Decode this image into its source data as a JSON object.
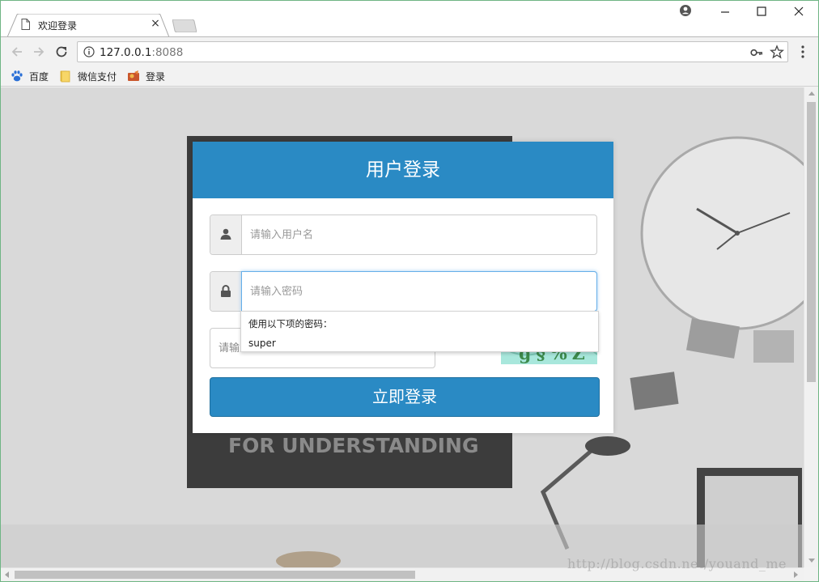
{
  "browser": {
    "tab_title": "欢迎登录",
    "tab_close": "×",
    "url_host": "127.0.0.1",
    "url_port": ":8088",
    "bookmarks": [
      {
        "label": "百度",
        "icon": "baidu-paw-icon"
      },
      {
        "label": "微信支付",
        "icon": "folder-icon"
      },
      {
        "label": "登录",
        "icon": "login-page-icon"
      }
    ]
  },
  "login": {
    "title": "用户登录",
    "username_placeholder": "请输入用户名",
    "password_placeholder": "请输入密码",
    "captcha_placeholder": "请输入验证码",
    "captcha_text": "g§%Z",
    "submit_label": "立即登录"
  },
  "autofill": {
    "title": "使用以下项的密码：",
    "item": "super"
  },
  "background": {
    "poster_text": "FOR UNDERSTANDING"
  },
  "watermark": "http://blog.csdn.net/youand_me",
  "colors": {
    "primary": "#2a8ac4",
    "focus": "#66afe9",
    "window_border": "#6fb584"
  }
}
